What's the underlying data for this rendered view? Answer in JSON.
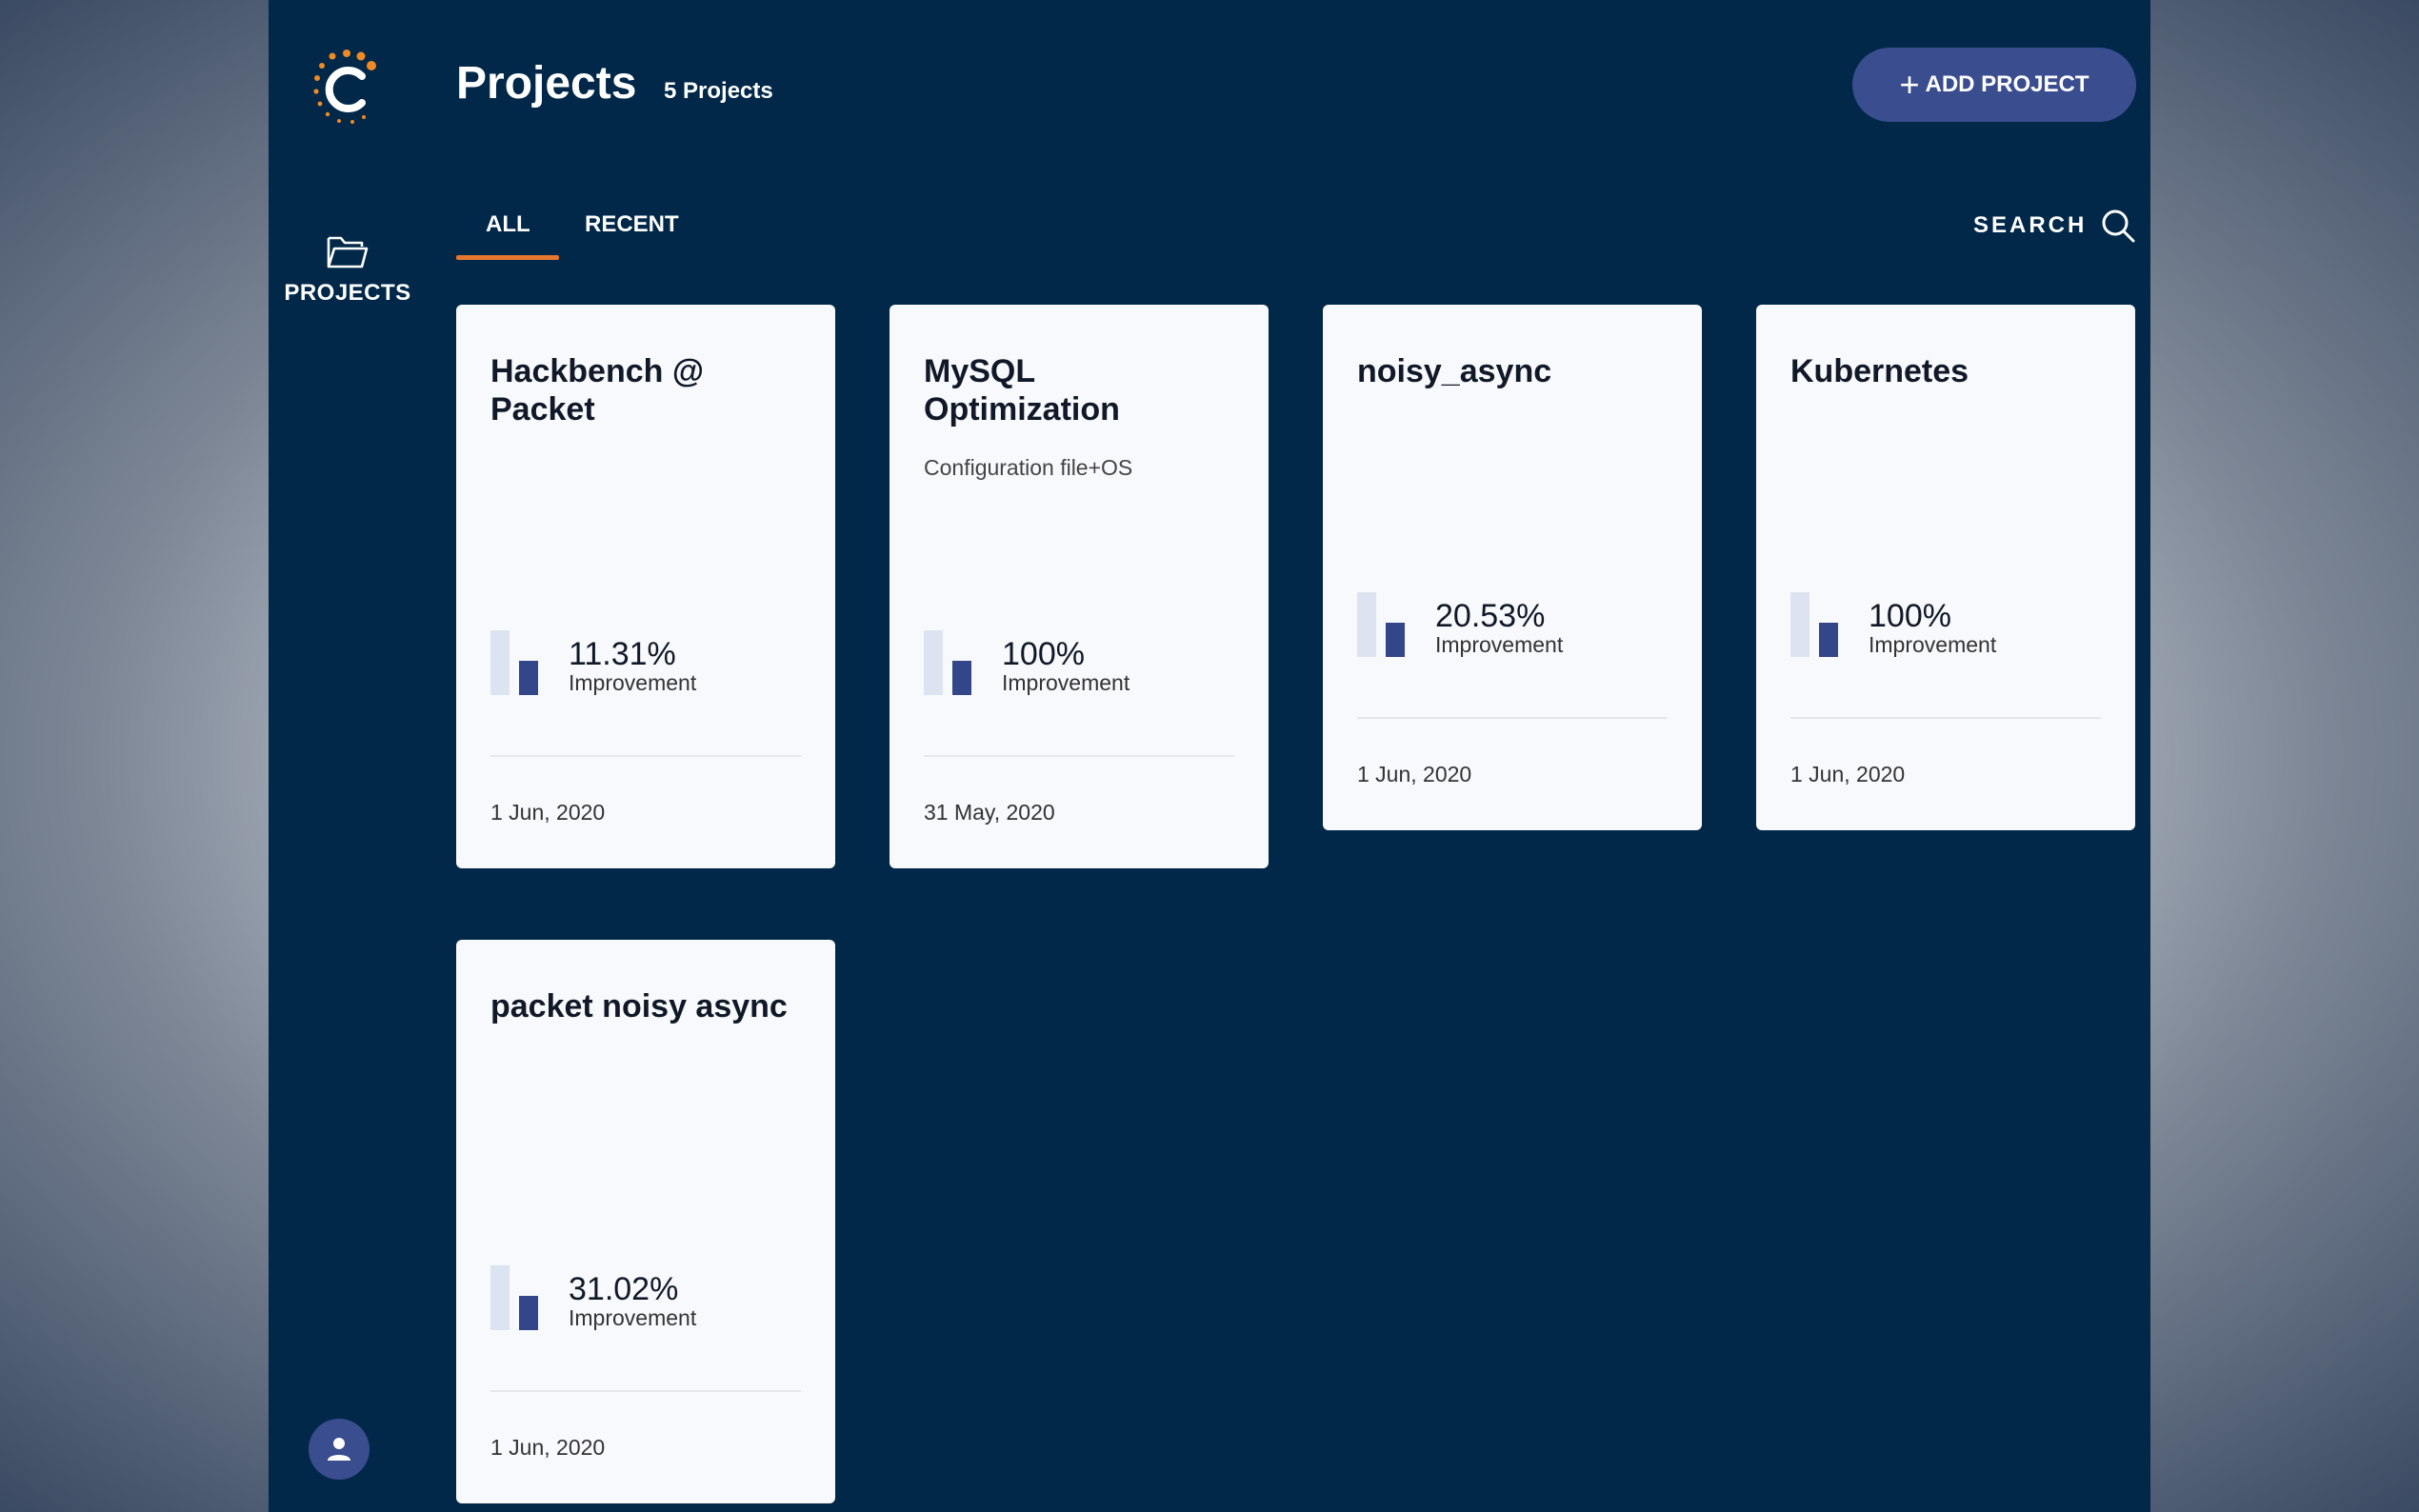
{
  "header": {
    "title": "Projects",
    "count": "5 Projects",
    "add_button": "ADD PROJECT"
  },
  "sidebar": {
    "logo_icon": "company-logo-icon",
    "items": [
      {
        "label": "PROJECTS",
        "icon": "folder-icon"
      }
    ],
    "avatar_icon": "user-icon"
  },
  "tabs": [
    {
      "label": "ALL",
      "active": true
    },
    {
      "label": "RECENT",
      "active": false
    }
  ],
  "search": {
    "label": "SEARCH",
    "icon": "search-icon"
  },
  "projects": [
    {
      "title": "Hackbench @ Packet",
      "description": "",
      "improvement": "11.31%",
      "improvement_label": "Improvement",
      "date": "1 Jun, 2020"
    },
    {
      "title": "MySQL Optimization",
      "description": "Configuration file+OS",
      "improvement": "100%",
      "improvement_label": "Improvement",
      "date": "31 May, 2020"
    },
    {
      "title": "noisy_async",
      "description": "",
      "improvement": "20.53%",
      "improvement_label": "Improvement",
      "date": "1 Jun, 2020"
    },
    {
      "title": "Kubernetes",
      "description": "",
      "improvement": "100%",
      "improvement_label": "Improvement",
      "date": "1 Jun, 2020"
    },
    {
      "title": "packet noisy async",
      "description": "",
      "improvement": "31.02%",
      "improvement_label": "Improvement",
      "date": "1 Jun, 2020"
    }
  ],
  "colors": {
    "background": "#012849",
    "accent": "#3a4d8f",
    "tab_underline": "#e8772e",
    "logo_orange": "#f08a24",
    "card": "#f7f9fc"
  }
}
